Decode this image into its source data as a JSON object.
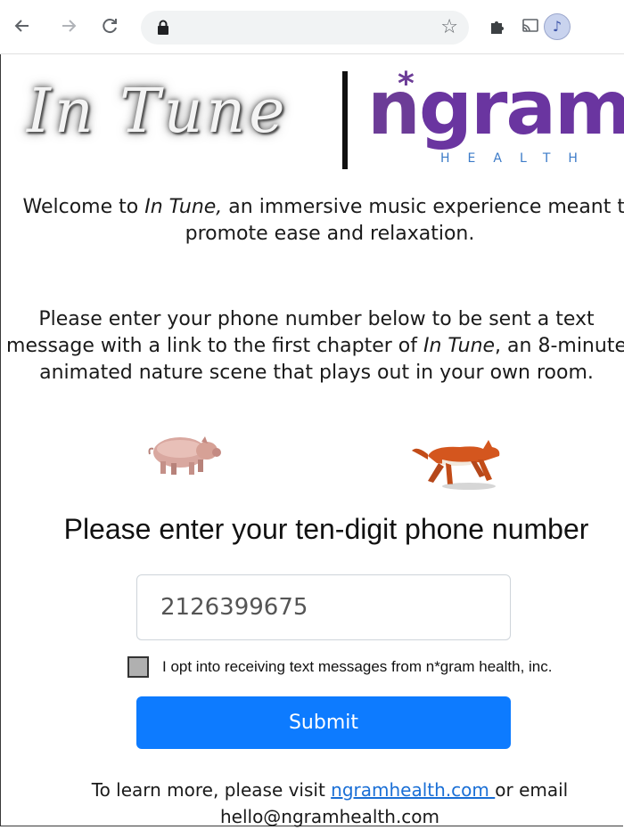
{
  "browser": {
    "nav_back_icon": "back-arrow-icon",
    "nav_forward_icon": "forward-arrow-icon",
    "reload_icon": "reload-icon",
    "address_url": ""
  },
  "logos": {
    "intune": "In Tune",
    "ngram_n": "n",
    "ngram_star": "*",
    "ngram_rest": "gram",
    "health": "HEALTH"
  },
  "welcome": {
    "prefix": "Welcome to ",
    "emph": "In Tune,",
    "suffix": " an immersive music experience meant to promote ease and relaxation."
  },
  "instructions": {
    "prefix": "Please enter your phone number below to be sent a text message with a link to the first chapter of ",
    "emph": "In Tune",
    "suffix": ", an 8-minute animated nature scene that plays out in your own room."
  },
  "form": {
    "heading": "Please enter your ten-digit phone number",
    "phone_value": "2126399675",
    "opt_in_label": "I opt into receiving text messages from n*gram health, inc.",
    "submit_label": "Submit"
  },
  "footer": {
    "prefix": "To learn more, please visit ",
    "link_text": "ngramhealth.com ",
    "middle": "or email",
    "email": "hello@ngramhealth.com"
  },
  "colors": {
    "submit_bg": "#0d7bff",
    "ngram_purple": "#6c3c97",
    "health_blue": "#3c7bc8",
    "link": "#1a6fd6"
  }
}
